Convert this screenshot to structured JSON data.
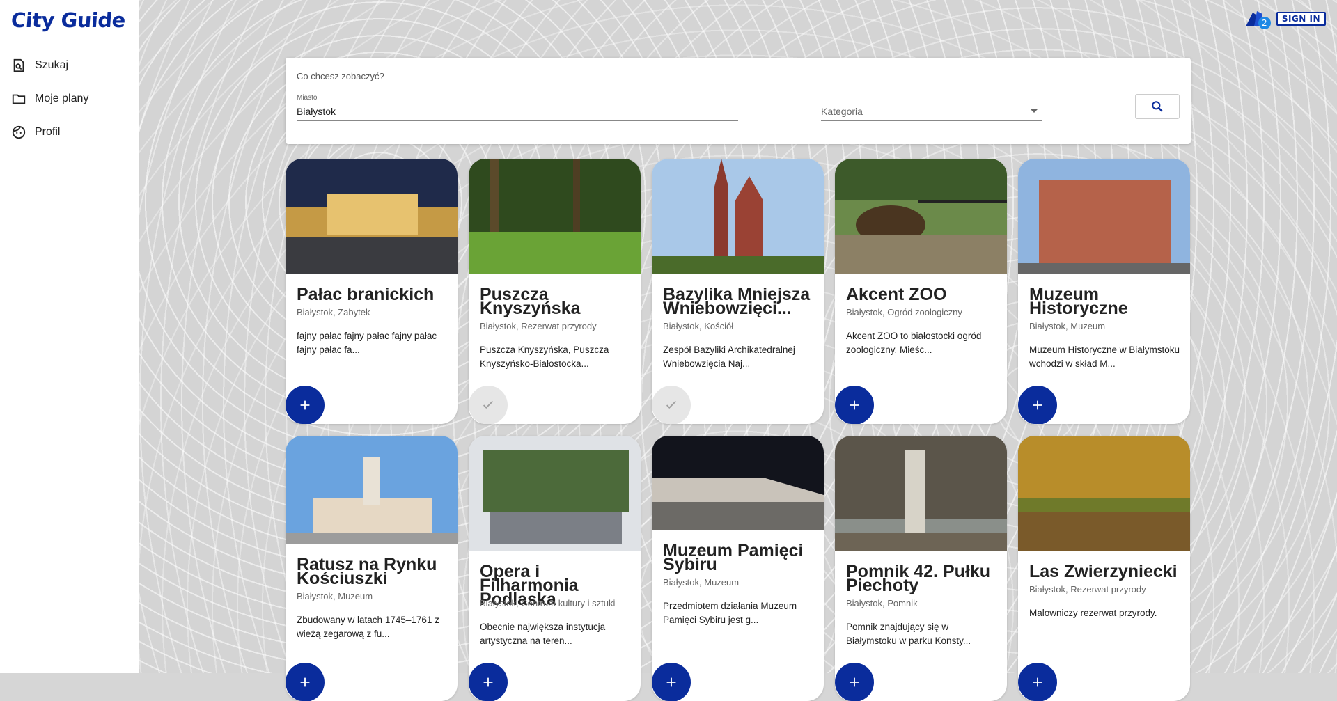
{
  "app": {
    "logo": "City Guide"
  },
  "sidebar": {
    "items": [
      {
        "label": "Szukaj",
        "icon": "search-doc-icon"
      },
      {
        "label": "Moje plany",
        "icon": "folder-icon"
      },
      {
        "label": "Profil",
        "icon": "face-icon"
      }
    ]
  },
  "header": {
    "badge_count": "2",
    "signin_label": "SIGN IN",
    "icon": "app-logo-icon"
  },
  "search": {
    "title": "Co chcesz zobaczyć?",
    "city_label": "Miasto",
    "city_value": "Białystok",
    "category_placeholder": "Kategoria",
    "button_icon": "search-icon"
  },
  "colors": {
    "accent": "#0a2c9c",
    "done": "#e6e6e6"
  },
  "cards": [
    {
      "title": "Pałac branickich",
      "subtitle": "Białystok, Zabytek",
      "desc": "fajny pałac fajny pałac fajny pałac fajny pałac fa...",
      "action": "add"
    },
    {
      "title": "Puszcza Knyszyńska",
      "subtitle": "Białystok, Rezerwat przyrody",
      "desc": "Puszcza Knyszyńska, Puszcza Knyszyńsko-Białostocka...",
      "action": "done"
    },
    {
      "title": "Bazylika Mniejsza Wniebowzięci...",
      "subtitle": "Białystok, Kościół",
      "desc": "Zespół Bazyliki Archikatedralnej Wniebowzięcia Naj...",
      "action": "done"
    },
    {
      "title": "Akcent ZOO",
      "subtitle": "Białystok, Ogród zoologiczny",
      "desc": "Akcent ZOO to białostocki ogród zoologiczny. Mieśc...",
      "action": "add"
    },
    {
      "title": "Muzeum Historyczne",
      "subtitle": "Białystok, Muzeum",
      "desc": "Muzeum Historyczne w Białymstoku wchodzi w skład M...",
      "action": "add"
    },
    {
      "title": "Ratusz na Rynku Kościuszki",
      "subtitle": "Białystok, Muzeum",
      "desc": "Zbudowany w latach 1745–1761 z wieżą zegarową z fu...",
      "action": "add"
    },
    {
      "title": "Opera i Filharmonia Podlaska",
      "subtitle": "Białystok, Centrum kultury i sztuki",
      "desc": "Obecnie największa instytucja artystyczna na teren...",
      "action": "add"
    },
    {
      "title": "Muzeum Pamięci Sybiru",
      "subtitle": "Białystok, Muzeum",
      "desc": "Przedmiotem działania Muzeum Pamięci Sybiru jest g...",
      "action": "add"
    },
    {
      "title": "Pomnik 42. Pułku Piechoty",
      "subtitle": "Białystok, Pomnik",
      "desc": "Pomnik znajdujący się w Białymstoku w parku Konsty...",
      "action": "add"
    },
    {
      "title": "Las Zwierzyniecki",
      "subtitle": "Białystok, Rezerwat przyrody",
      "desc": "Malowniczy rezerwat przyrody.",
      "action": "add"
    }
  ]
}
